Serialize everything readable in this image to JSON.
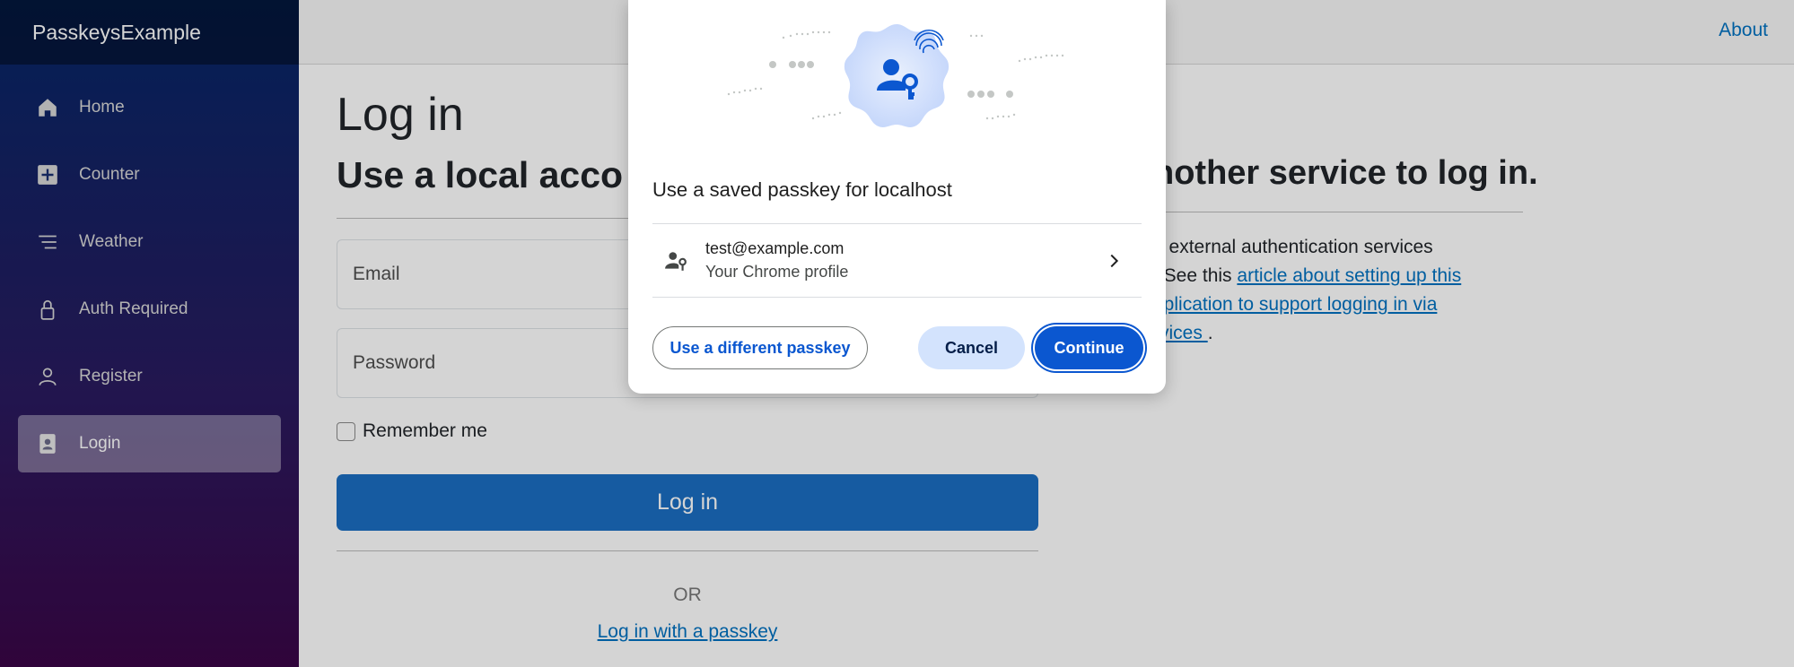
{
  "app": {
    "brand": "PasskeysExample",
    "about": "About"
  },
  "sidebar": {
    "items": [
      {
        "label": "Home",
        "icon": "home-icon"
      },
      {
        "label": "Counter",
        "icon": "plus-square-icon"
      },
      {
        "label": "Weather",
        "icon": "list-icon"
      },
      {
        "label": "Auth Required",
        "icon": "lock-icon"
      },
      {
        "label": "Register",
        "icon": "person-icon"
      },
      {
        "label": "Login",
        "icon": "badge-icon",
        "active": true
      }
    ]
  },
  "main": {
    "title": "Log in",
    "subtitle_left": "Use a local acco",
    "subtitle_right": "nother service to log in.",
    "email_placeholder": "Email",
    "password_placeholder": "Password",
    "remember_label": "Remember me",
    "login_button": "Log in",
    "or_text": "OR",
    "passkey_link": "Log in with a passkey",
    "ext_line1": "o external authentication services",
    "ext_line2_prefix": ". See this ",
    "ext_link_a": "article about setting up this",
    "ext_link_b": "pplication to support logging in via",
    "ext_link_c": "rvices ",
    "ext_suffix": "."
  },
  "dialog": {
    "title": "Use a saved passkey for localhost",
    "account_email": "test@example.com",
    "account_sub": "Your Chrome profile",
    "btn_different": "Use a different passkey",
    "btn_cancel": "Cancel",
    "btn_continue": "Continue"
  },
  "colors": {
    "accent": "#1b6ec2",
    "chrome_blue": "#0b57d0",
    "link": "#0071c1"
  }
}
